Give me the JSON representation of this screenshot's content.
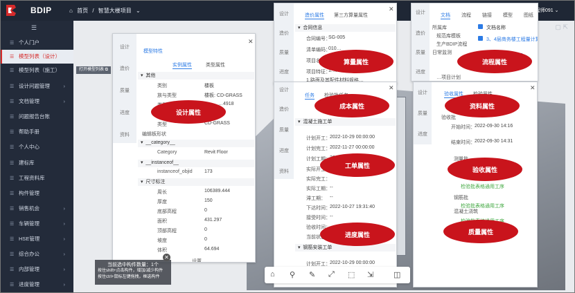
{
  "header": {
    "app_name": "BDIP",
    "breadcrumb": [
      "首页",
      "/",
      "智慧大楼项目",
      "⌄"
    ],
    "user": "工程师091 ⌄"
  },
  "sidebar": {
    "collapse_icon": "☰",
    "items": [
      {
        "label": "个人门户",
        "arrow": ""
      },
      {
        "label": "模型列表（设计）",
        "arrow": ""
      },
      {
        "label": "模型列表（施工）",
        "arrow": ""
      },
      {
        "label": "设计问题管理",
        "arrow": "›"
      },
      {
        "label": "文档管理",
        "arrow": "›"
      },
      {
        "label": "问题报告台账",
        "arrow": ""
      },
      {
        "label": "帮助手册",
        "arrow": ""
      },
      {
        "label": "个人中心",
        "arrow": ""
      },
      {
        "label": "建标库",
        "arrow": ""
      },
      {
        "label": "工程资料库",
        "arrow": ""
      },
      {
        "label": "构件管理",
        "arrow": ""
      },
      {
        "label": "销售机会",
        "arrow": "›"
      },
      {
        "label": "车辆管理",
        "arrow": "›"
      },
      {
        "label": "HSE管理",
        "arrow": "›"
      },
      {
        "label": "综合办公",
        "arrow": "›"
      },
      {
        "label": "内部管理",
        "arrow": "›"
      },
      {
        "label": "进度管理",
        "arrow": "›"
      }
    ]
  },
  "main": {
    "open_list_button": "打开模型列表 ⧉",
    "selection_info": [
      "当前选中构件数量：1个",
      "按住shift+点击构件，增加/减少构件",
      "按住ctrl+鼠标左键拖拽，框选构件"
    ]
  },
  "panel_design": {
    "vtabs": [
      "设计",
      "造价",
      "质量",
      "进度",
      "资料"
    ],
    "title": "模型特性",
    "tabs": [
      "实例属性",
      "类型属性"
    ],
    "sections": [
      {
        "name": "其他",
        "rows": [
          [
            "类别",
            "楼板"
          ],
          [
            "族与类型",
            "楼板: CD-GRASS"
          ],
          [
            "类型",
            "…4918"
          ],
          [
            "",
            ""
          ],
          [
            "类型",
            "CD-GRASS"
          ]
        ]
      },
      {
        "name": "编辑板形状",
        "rows": []
      },
      {
        "name": "__category__",
        "rows": [
          [
            "Category",
            "Revit Floor"
          ]
        ]
      },
      {
        "name": "__instanceof__",
        "rows": [
          [
            "instanceof_objid",
            "173"
          ]
        ]
      },
      {
        "name": "尺寸标注",
        "rows": [
          [
            "周长",
            "106389.444"
          ],
          [
            "厚度",
            "150"
          ],
          [
            "底部高程",
            "0"
          ],
          [
            "面积",
            "431.297"
          ],
          [
            "顶部高程",
            "0"
          ],
          [
            "坡度",
            "0"
          ],
          [
            "体积",
            "64.694"
          ]
        ]
      }
    ],
    "footer": "设置",
    "oval": "设计属性"
  },
  "panel_cost": {
    "vtabs": [
      "设计",
      "造价",
      "质量",
      "进度"
    ],
    "tabs": [
      "造价属性",
      "第三方算量属性"
    ],
    "section": "合同信息",
    "rows": [
      [
        "合同编号：",
        "SG-005"
      ],
      [
        "清单编码：",
        "010…"
      ],
      [
        "项目名称：",
        ""
      ],
      [
        "项目特征：",
        "1.…"
      ],
      [
        "",
        "1.路面及其配件材料规格…"
      ]
    ],
    "oval": "算量属性"
  },
  "panel_task": {
    "vtabs": [
      "设计",
      "造价",
      "质量",
      "进度",
      "资料"
    ],
    "tabs": [
      "任务",
      "检验批任务"
    ],
    "section1": "混凝土施工单",
    "rows": [
      [
        "计划开工：",
        "2022-10-29 00:00:00"
      ],
      [
        "计划完工：",
        "2022-11-27 00:00:00"
      ],
      [
        "计划工期：",
        "30"
      ],
      [
        "实际开工：",
        ""
      ],
      [
        "实际完工：",
        ""
      ],
      [
        "实际工期：",
        "--"
      ],
      [
        "滞工期：",
        "--"
      ],
      [
        "下达时间：",
        "2022-10-27 19:31:40"
      ],
      [
        "接受时间：",
        "--"
      ],
      [
        "验收时间：",
        ""
      ],
      [
        "当前状态：",
        ""
      ]
    ],
    "section2": "钢筋安装工单",
    "rows2": [
      [
        "计划开工：",
        "2022-10-29 00:00:00"
      ]
    ],
    "oval_cost": "成本属性",
    "oval_work": "工单属性",
    "oval_progress": "进度属性"
  },
  "panel_doc": {
    "vtabs": [
      "设计",
      "造价",
      "质量",
      "进度"
    ],
    "tabs": [
      "文档",
      "流程",
      "链接",
      "模型",
      "图纸"
    ],
    "check_label": "文档名称",
    "rows": [
      "所属库",
      "规范库模板",
      "生产BDIP流程",
      "日常监测",
      "…项目计划"
    ],
    "doc_item": "3、4层商务楼工程量计算书",
    "oval": "流程属性"
  },
  "panel_quality": {
    "vtabs": [
      "设计",
      "质量",
      "进度"
    ],
    "tabs": [
      "验收属性",
      "检验属性"
    ],
    "rows": [
      [
        "开始时间：",
        "2022-09-30 14:16"
      ],
      [
        "结束时间：",
        "2022-09-30 14:31"
      ]
    ],
    "sections": [
      "验收批",
      "测量批",
      "钢筋批",
      "混凝土浇筑"
    ],
    "links": [
      "检验批表格通用工序",
      "检验批表格通用工序",
      "检验批表格通用工序"
    ],
    "oval_data": "资料属性",
    "oval_accept": "验收属性",
    "oval_quality": "质量属性"
  },
  "toolbar": {
    "tools": [
      "⌂",
      "⚲",
      "✎",
      "⤢",
      "⬚",
      "⇲",
      "◫"
    ]
  },
  "colors": {
    "accent": "#d62b2b",
    "oval": "#c9141c",
    "link": "#2c7be5",
    "sidebar": "#232b3a"
  }
}
